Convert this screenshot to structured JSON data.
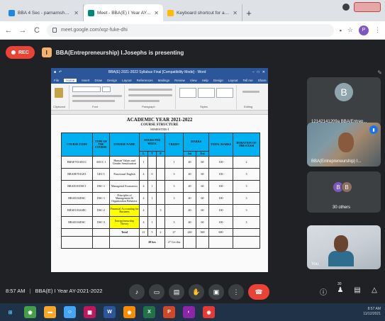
{
  "browser": {
    "tabs": [
      {
        "label": "BBA 4 Sec - parnarnshu@jpsvor",
        "color": "#1e88e5",
        "active": false
      },
      {
        "label": "Meet - BBA(E) I Year AY-202",
        "color": "#00897b",
        "active": true
      },
      {
        "label": "Keyboard shortcut for animation",
        "color": "#fbbc04",
        "active": false
      }
    ],
    "new_tab": "+",
    "url": "meet.google.com/xqz-fuke-dhi",
    "profile_initial": "P"
  },
  "meet": {
    "rec_label": "REC",
    "presenting_text": "BBA(Entrepreneurship) I.Josephs is presenting",
    "presenting_icon": "I",
    "meeting_time": "8:57 AM",
    "meeting_name": "BBA(E) I Year AY-2021-2022",
    "raise_count": "30",
    "participants": [
      {
        "name": "12142141209a BBA(Entrep...",
        "initial": "B",
        "kind": "avatar"
      },
      {
        "name": "BBA(Entrepreneurship) I...",
        "kind": "camera"
      },
      {
        "name": "30 others",
        "initials": [
          "B",
          "B"
        ],
        "kind": "others"
      },
      {
        "name": "You",
        "kind": "self"
      }
    ]
  },
  "word": {
    "title": "BBA(E) 2021-2022 Syllabus Final [Compatibility Mode] - Word",
    "menu": [
      "File",
      "Home",
      "Insert",
      "Draw",
      "Design",
      "Layout",
      "References",
      "Mailings",
      "Review",
      "View",
      "Help",
      "Design",
      "Layout",
      "Tell me",
      "Share"
    ],
    "menu_selected": "Home",
    "ribbon_groups": [
      "Clipboard",
      "Font",
      "Paragraph",
      "Styles",
      "Editing"
    ],
    "doc_title": "ACADEMIC YEAR 2021-2022",
    "doc_subtitle": "COURSE STRUCTURE",
    "doc_semester": "SEMESTER-I",
    "table": {
      "headers": [
        "COURSE CODE",
        "TYPE OF THE COURSE",
        "COURSE NAME",
        "HOURS PER WEEK",
        "CREDIT",
        "MARKS",
        "TOTAL MARKS",
        "DURATION OF THE EXAM"
      ],
      "sub_headers": [
        "L",
        "T",
        "P",
        "Int",
        "Ext"
      ],
      "rows": [
        [
          "BBAE701AECC",
          "AECC 1",
          "Human Values and Gender Sensitization",
          "1",
          "",
          "",
          "1",
          "40",
          "60",
          "100",
          "2"
        ],
        [
          "BBAEE701GE1",
          "GE1-1",
          "Functional English",
          "4",
          "0",
          "",
          "3",
          "40",
          "60",
          "100",
          "3"
        ],
        [
          "BBAE101DSC1",
          "DSC-1",
          "Managerial Economics",
          "4",
          "1",
          "",
          "3",
          "40",
          "60",
          "100",
          "3"
        ],
        [
          "BBAE102DSC",
          "DSC-1",
          "Principles of Management & Organization Behavior",
          "4",
          "1",
          "",
          "3",
          "40",
          "60",
          "100",
          "3"
        ],
        [
          "BBAE103ASEC",
          "DSC-2",
          "Financial Accounting for Business",
          "4",
          "",
          "3",
          "",
          "40",
          "60",
          "100",
          "3"
        ],
        [
          "BBAE104DSC",
          "DSC-3",
          "Entrepreneurship Theory",
          "4",
          "1",
          "",
          "3",
          "40",
          "60",
          "100",
          "3"
        ]
      ],
      "total": {
        "label": "Total",
        "L": "21",
        "T": "5",
        "P": "2",
        "credit": "27",
        "int": "240",
        "ext": "360",
        "total": "600"
      },
      "extra": {
        "hours": "28 hrs",
        "credit": "27 Cre dits"
      }
    }
  },
  "controls": [
    "mic-icon",
    "camera-icon",
    "captions-icon",
    "raise-hand-icon",
    "present-icon",
    "more-icon",
    "end-call-icon"
  ],
  "taskbar": {
    "apps": [
      {
        "icon": "windows-logo-icon",
        "glyph": "⊞",
        "color": "#1f3247"
      },
      {
        "icon": "chrome-icon",
        "glyph": "◉",
        "color": "#43a047"
      },
      {
        "icon": "folder-icon",
        "glyph": "▬",
        "color": "#f9a825"
      },
      {
        "icon": "people-icon",
        "glyph": "☺",
        "color": "#42a5f5"
      },
      {
        "icon": "store-icon",
        "glyph": "▦",
        "color": "#c2185b"
      },
      {
        "icon": "word-icon",
        "glyph": "W",
        "color": "#2b579a"
      },
      {
        "icon": "chrome-icon-2",
        "glyph": "◉",
        "color": "#fb8c00"
      },
      {
        "icon": "excel-icon",
        "glyph": "X",
        "color": "#217346"
      },
      {
        "icon": "powerpoint-icon",
        "glyph": "P",
        "color": "#d24726"
      },
      {
        "icon": "app-icon",
        "glyph": "◐",
        "color": "#8e24aa"
      },
      {
        "icon": "chrome-icon-3",
        "glyph": "◉",
        "color": "#e53935"
      }
    ],
    "time": "8:57 AM",
    "date": "11/12/2021"
  }
}
